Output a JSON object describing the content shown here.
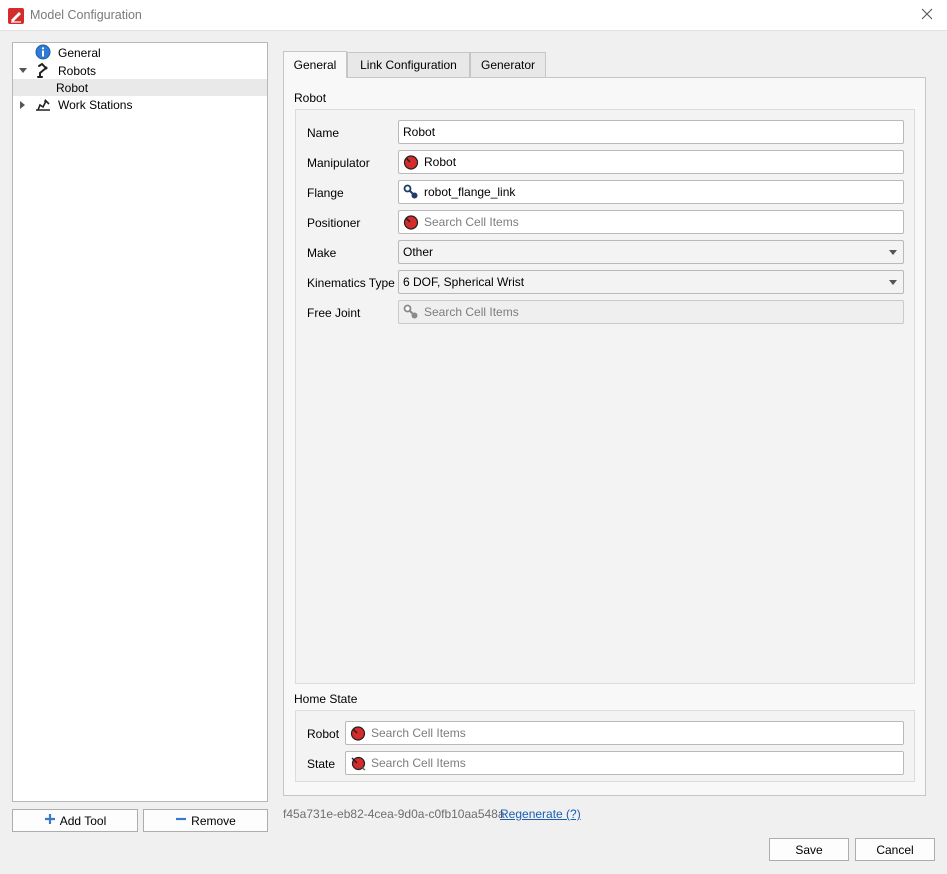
{
  "window": {
    "title": "Model Configuration"
  },
  "tree": {
    "items": [
      {
        "label": "General",
        "icon": "info-icon",
        "level": 0,
        "expanded": null
      },
      {
        "label": "Robots",
        "icon": "robot-arm-icon",
        "level": 0,
        "expanded": true
      },
      {
        "label": "Robot",
        "icon": "",
        "level": 1,
        "selected": true
      },
      {
        "label": "Work Stations",
        "icon": "workstation-icon",
        "level": 0,
        "expanded": false
      }
    ]
  },
  "buttons": {
    "add_tool": "Add Tool",
    "remove": "Remove",
    "save": "Save",
    "cancel": "Cancel"
  },
  "tabs": [
    {
      "label": "General",
      "active": true
    },
    {
      "label": "Link Configuration",
      "active": false
    },
    {
      "label": "Generator",
      "active": false
    }
  ],
  "robot_section": {
    "title": "Robot",
    "fields": [
      {
        "label": "Name",
        "value": "Robot",
        "placeholder": "",
        "icon": ""
      },
      {
        "label": "Manipulator",
        "value": "Robot",
        "placeholder": "",
        "icon": "robot-item-icon"
      },
      {
        "label": "Flange",
        "value": "robot_flange_link",
        "placeholder": "",
        "icon": "link-icon"
      },
      {
        "label": "Positioner",
        "value": "",
        "placeholder": "Search Cell Items",
        "icon": "robot-item-icon"
      },
      {
        "label": "Make",
        "value": "Other",
        "type": "dropdown"
      },
      {
        "label": "Kinematics Type",
        "value": "6 DOF, Spherical Wrist",
        "type": "dropdown"
      },
      {
        "label": "Free Joint",
        "value": "",
        "placeholder": "Search Cell Items",
        "icon": "link-icon",
        "disabled": true
      }
    ]
  },
  "home_state_section": {
    "title": "Home State",
    "fields": [
      {
        "label": "Robot",
        "placeholder": "Search Cell Items",
        "icon": "robot-item-icon"
      },
      {
        "label": "State",
        "placeholder": "Search Cell Items",
        "icon": "robot-state-icon"
      }
    ]
  },
  "footer": {
    "uuid": "f45a731e-eb82-4cea-9d0a-c0fb10aa548a",
    "regenerate": "Regenerate (?)"
  },
  "colors": {
    "accent_red": "#d42b2b",
    "link_blue": "#1a5fb4",
    "info_blue": "#2e7bd6"
  }
}
